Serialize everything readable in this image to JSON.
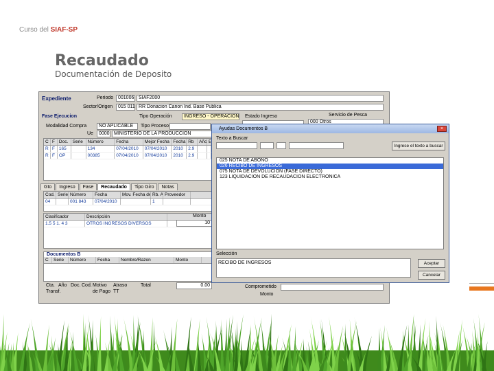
{
  "slide": {
    "course_prefix": "Curso del ",
    "course_highlight": "SIAF-SP",
    "title": "Recaudado",
    "subtitle": "Documentación de Deposito"
  },
  "app": {
    "expediente_label": "Expediente",
    "periodo_label": "Periodo",
    "periodo_value": "001006",
    "entidad_value": "SIAF2000",
    "sector_label": "Sector/Origen",
    "sector_value": "015 011",
    "sector_desc": "RR Donacion Canon Ind. Base Publica",
    "fase_label": "Fase Ejecucion",
    "tipo_op_label": "Tipo Operación",
    "tipo_op_value": "INGRESO - OPERACION",
    "estado_label": "Estado Ingreso",
    "modalidad_label": "Modalidad Compra",
    "modalidad_value": "NO APLICABLE",
    "tipo_proc_label": "Tipo Proceso",
    "ue_label": "Ue",
    "ue_value": "0000",
    "ue_desc": "MINISTERIO DE LA PRODUCCION",
    "servicio_label": "Servicio de Pesca",
    "servicio_value": "000 Otros",
    "grid_headers": [
      "C",
      "F",
      "Doc.",
      "Serie",
      "Número",
      "Fecha",
      "Mejor Fecha",
      "Fecha",
      "Rb",
      "Año",
      "E"
    ],
    "grid_rows": [
      [
        "R",
        "F",
        "165",
        "",
        "134",
        "07/04/2010",
        "07/04/2010",
        "2010",
        "2.9",
        "",
        ""
      ],
      [
        "R",
        "F",
        "OP",
        "",
        "00385",
        "07/04/2010",
        "07/04/2010",
        "2010",
        "2.9",
        "",
        ""
      ]
    ],
    "tabs": [
      "Gto",
      "Ingreso",
      "Fase",
      "Recaudado",
      "Tipo Giro",
      "Notas"
    ],
    "doc_headers": [
      "Cod.",
      "Serie",
      "Número",
      "Fecha",
      "Mov. Fecha de Pago",
      "Rb. A",
      "Proveedor"
    ],
    "doc_row": [
      "04",
      "",
      "001 843",
      "07/04/2010",
      "",
      "1",
      ""
    ],
    "clasif_label": "Clasificador",
    "descripcion_label": "Descripción",
    "monto_label": "Monto",
    "clasif_value": "1.5 5 1. 4 3",
    "clasif_desc": "OTROS INGRESOS DIVERSOS",
    "monto_value": "10",
    "docs_label": "Documentos B",
    "docs_headers": [
      "C",
      "Serie",
      "Número",
      "Fecha",
      "Nombre/Razon",
      "Monto"
    ],
    "bottom_labels": [
      "Cta.",
      "Año",
      "Doc.",
      "Cod.",
      "Motivo",
      "Atraso",
      "Total"
    ],
    "bottom_labels2": [
      "Transf.",
      "",
      "",
      "",
      "de Pago",
      "TT"
    ],
    "total_value": "0.00",
    "comprometido_label": "Comprometido",
    "monto_label2": "Monto"
  },
  "dialog": {
    "title": "Ayudas Documentos B",
    "search_label": "Texto a Buscar",
    "search_button": "Ingrese el texto a buscar",
    "items": [
      "025  NOTA DE ABONO",
      "026  RECIBO DE INGRESOS",
      "075  NOTA DE DEVOLUCION (FASE DIRECTO)",
      "123  LIQUIDACION DE RECAUDACION ELECTRONICA"
    ],
    "selected_index": 1,
    "seleccion_label": "Selección",
    "seleccion_value": "RECIBO DE INGRESOS",
    "aceptar_button": "Aceptar",
    "cancelar_button": "Cancelar"
  }
}
